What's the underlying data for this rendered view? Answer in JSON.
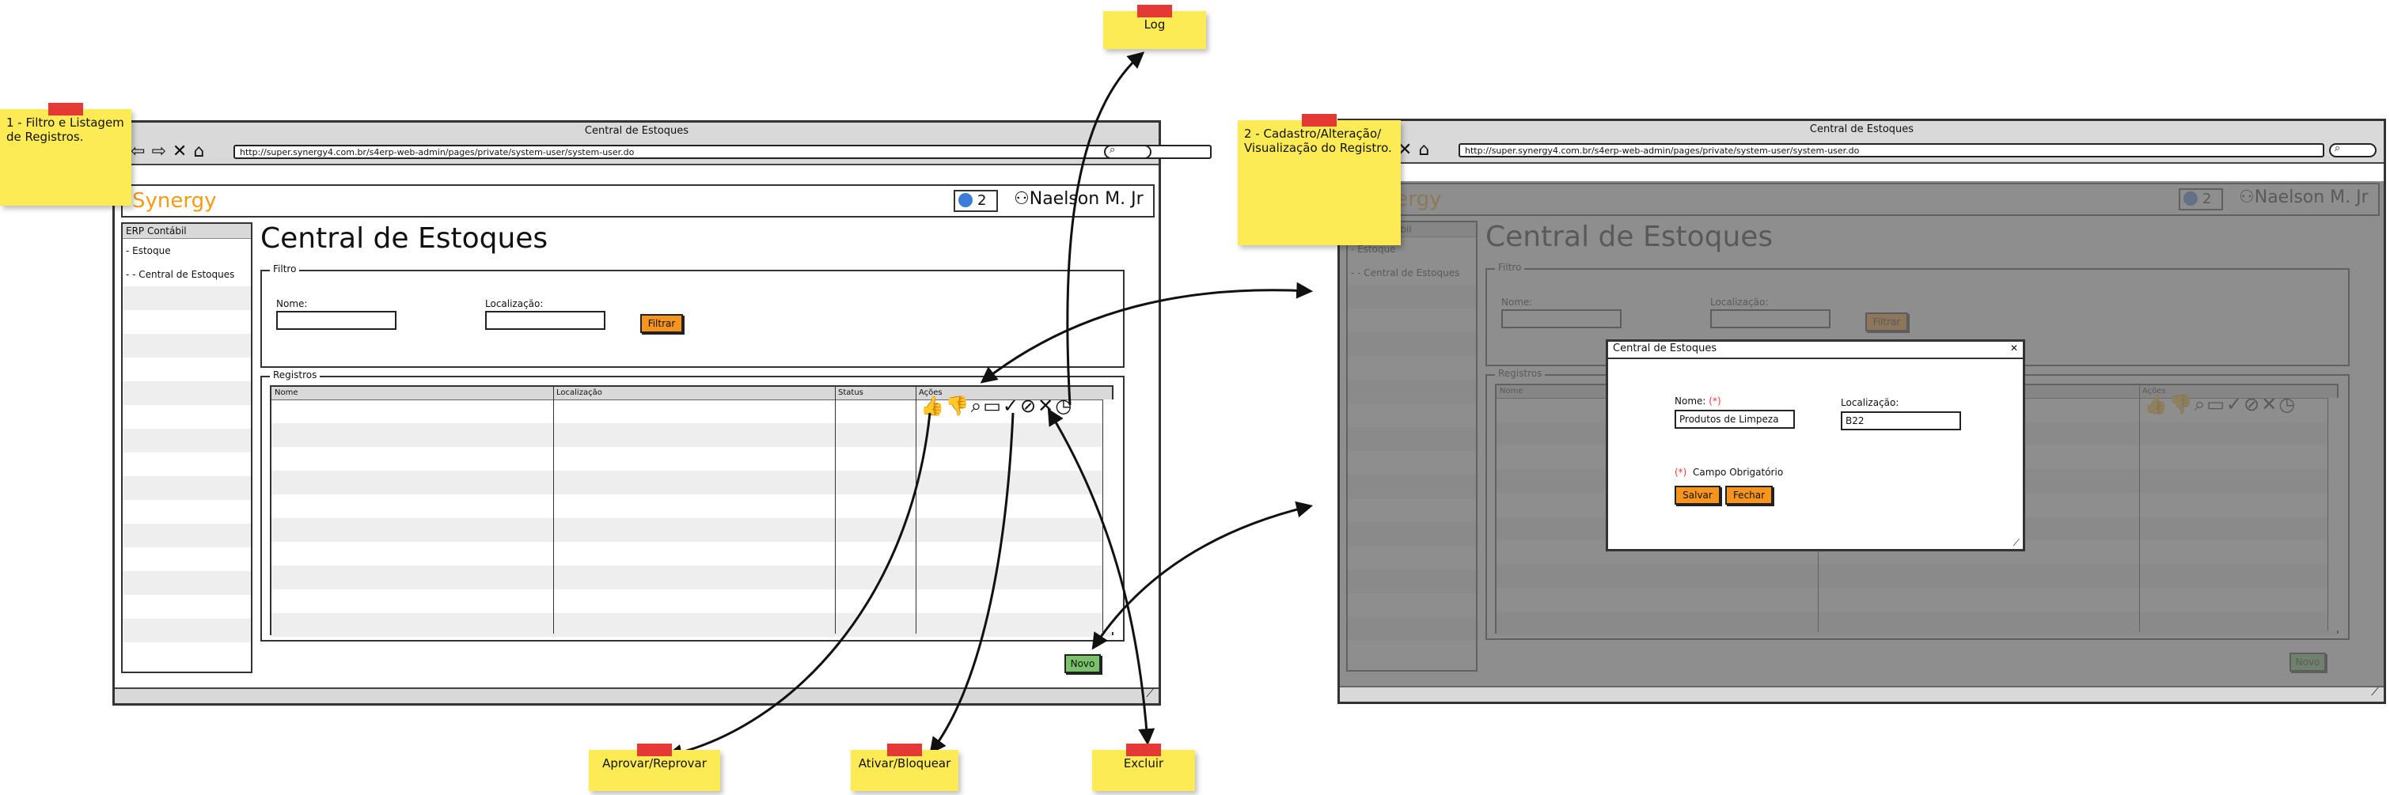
{
  "browser": {
    "window_title": "Central de Estoques",
    "url": "http://super.synergy4.com.br/s4erp-web-admin/pages/private/system-user/system-user.do"
  },
  "app": {
    "brand": "Synergy",
    "notif_count": "2",
    "user_name": "Naelson M. Jr",
    "sidebar_header": "ERP Contábil",
    "sidebar_items": [
      "- Estoque",
      "- - Central de Estoques"
    ],
    "page_title": "Central de Estoques"
  },
  "filter": {
    "legend": "Filtro",
    "nome_label": "Nome:",
    "localizacao_label": "Localização:",
    "filtrar_button": "Filtrar"
  },
  "registros": {
    "legend": "Registros",
    "columns": [
      "Nome",
      "Localização",
      "Status",
      "Ações"
    ],
    "novo_button": "Novo"
  },
  "dialog": {
    "title": "Central de Estoques",
    "nome_label": "Nome:",
    "required_mark": "(*)",
    "nome_value": "Produtos de Limpeza",
    "localizacao_label": "Localização:",
    "localizacao_value": "B22",
    "required_note": "Campo Obrigatório",
    "salvar_button": "Salvar",
    "fechar_button": "Fechar"
  },
  "notes": {
    "note1": "1 - Filtro e Listagem de Registros.",
    "note2": "2 - Cadastro/Alteração/ Visualização do Registro.",
    "log": "Log",
    "aprovar": "Aprovar/Reprovar",
    "ativar": "Ativar/Bloquear",
    "excluir": "Excluir"
  },
  "colors": {
    "brand": "#f39c12",
    "button_orange": "#f7941d",
    "button_green": "#79c36a",
    "sticky": "#fdeb55",
    "tape": "#e53935"
  },
  "icons": [
    "back-arrow-icon",
    "forward-arrow-icon",
    "close-icon",
    "home-icon",
    "search-icon",
    "globe-icon",
    "user-icon",
    "thumbs-up-icon",
    "thumbs-down-icon",
    "search-icon",
    "folder-icon",
    "check-icon",
    "block-icon",
    "x-icon",
    "clock-icon",
    "resize-icon"
  ]
}
